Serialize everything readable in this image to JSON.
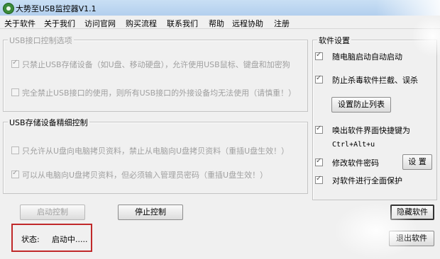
{
  "window": {
    "title": "大势至USB监控器V1.1"
  },
  "menu": [
    "关于软件",
    "关于我们",
    "访问官网",
    "购买流程",
    "联系我们",
    "帮助",
    "远程协助",
    "注册"
  ],
  "usb_port_group": {
    "title": "USB接口控制选项",
    "options": [
      {
        "label": "只禁止USB存储设备（如U盘、移动硬盘），允许使用USB鼠标、键盘和加密狗",
        "checked": true
      },
      {
        "label": "完全禁止USB接口的使用，则所有USB接口的外接设备均无法使用（请慎重！）",
        "checked": false
      }
    ]
  },
  "usb_storage_group": {
    "title": "USB存储设备精细控制",
    "options": [
      {
        "label": "只允许从U盘向电脑拷贝资料，禁止从电脑向U盘拷贝资料（重插U盘生效！）",
        "checked": false
      },
      {
        "label": "可以从电脑向U盘拷贝资料，但必须输入管理员密码（重插U盘生效！）",
        "checked": true
      }
    ]
  },
  "software_settings": {
    "title": "软件设置",
    "autostart": {
      "label": "随电脑启动自动启动",
      "checked": true
    },
    "antikill": {
      "label": "防止杀毒软件拦截、误杀",
      "checked": true
    },
    "antikill_button": "设置防止列表",
    "hotkey": {
      "label": "唤出软件界面快捷键为",
      "checked": true
    },
    "hotkey_value": "Ctrl+Alt+u",
    "password": {
      "label": "修改软件密码",
      "checked": true
    },
    "password_button": "设 置",
    "protect": {
      "label": "对软件进行全面保护",
      "checked": true
    }
  },
  "buttons": {
    "start": "启动控制",
    "stop": "停止控制",
    "hide": "隐藏软件",
    "exit": "退出软件"
  },
  "status": {
    "label": "状态:",
    "value": "启动中....."
  }
}
